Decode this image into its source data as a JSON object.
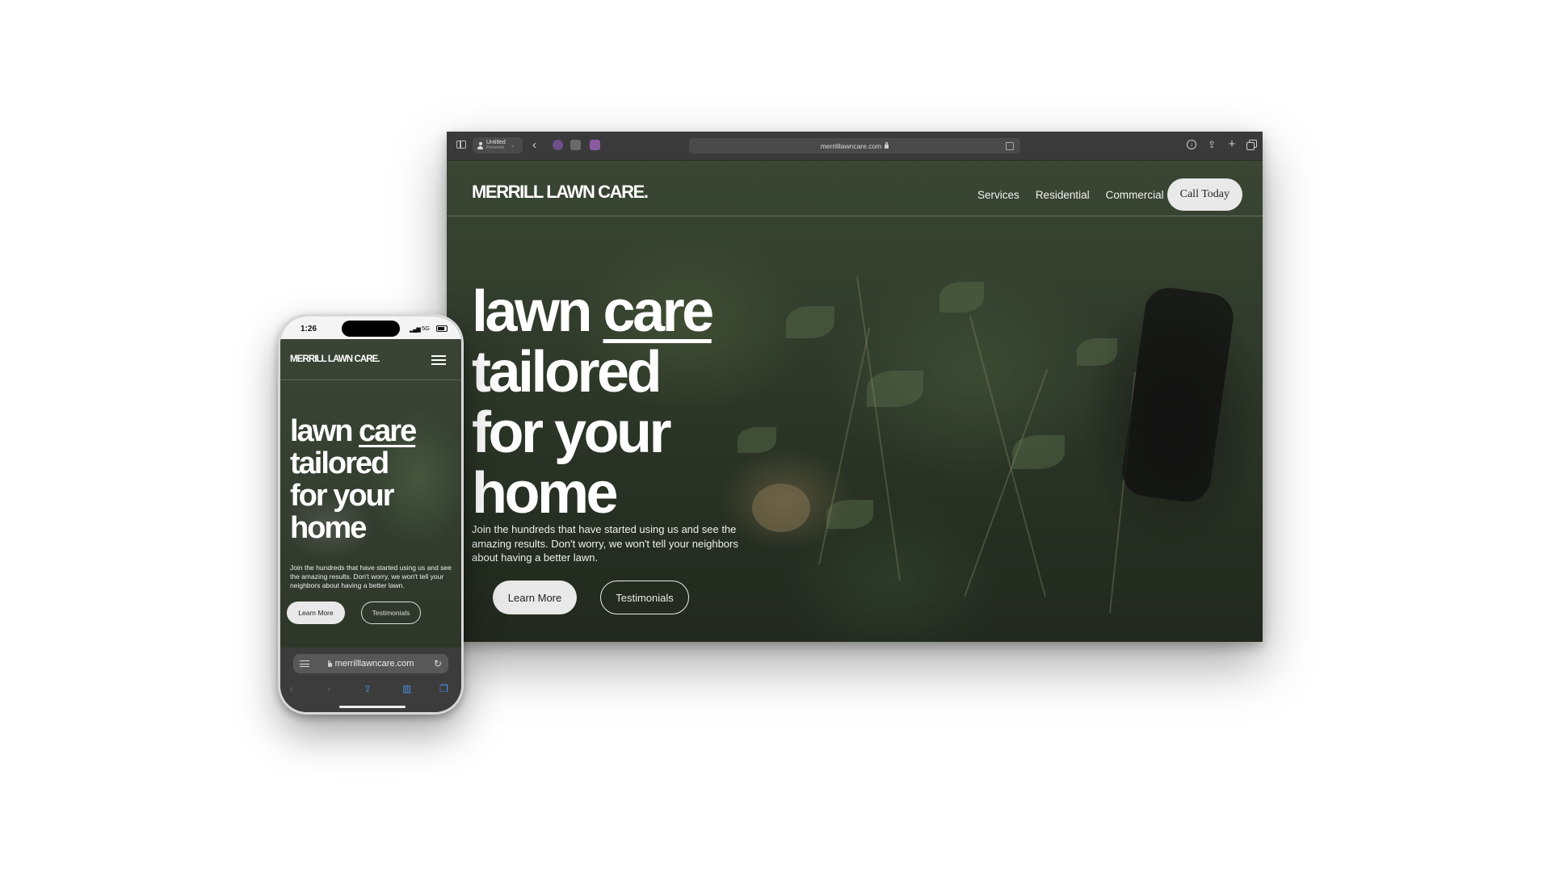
{
  "desktop": {
    "browser": {
      "profile_name": "Untitled",
      "profile_sub": "Personal",
      "url": "merrilllawncare.com"
    },
    "site": {
      "logo": "MERRILL LAWN CARE.",
      "nav": [
        "Services",
        "Residential",
        "Commercial"
      ],
      "cta": "Call Today",
      "headline_lines": [
        "lawn",
        "care",
        "tailored",
        "for your",
        "home"
      ],
      "subtext": "Join the hundreds that have started using us and see the amazing results. Don't worry, we won't tell your neighbors about having a better lawn.",
      "primary_button": "Learn More",
      "secondary_button": "Testimonials"
    }
  },
  "mobile": {
    "status": {
      "time": "1:26",
      "network": "5G"
    },
    "site": {
      "logo": "MERRILL LAWN CARE.",
      "headline_lines": [
        "lawn",
        "care",
        "tailored",
        "for your",
        "home"
      ],
      "subtext": "Join the hundreds that have started using us and see the amazing results. Don't worry, we won't tell your neighbors about having a better lawn.",
      "primary_button": "Learn More",
      "secondary_button": "Testimonials"
    },
    "browser": {
      "url": "merrilllawncare.com"
    }
  },
  "icons": {
    "sidebar": "sidebar-icon",
    "back": "chevron-left-icon",
    "download": "download-icon",
    "share": "share-icon",
    "new_tab": "plus-icon",
    "tabs": "tabs-overview-icon",
    "menu": "hamburger-icon",
    "lock": "lock-icon",
    "reload": "reload-icon"
  },
  "colors": {
    "hero_bg": "#2f3a2a",
    "button_bg": "#e9e9e9",
    "text": "#ffffff"
  }
}
